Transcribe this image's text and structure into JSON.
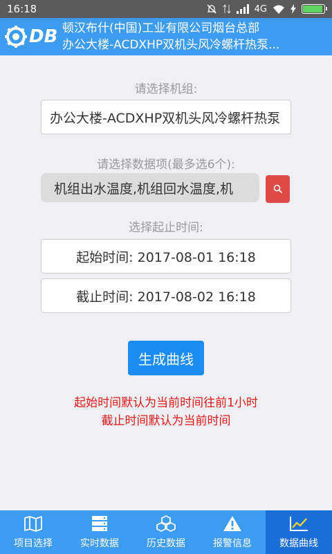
{
  "status": {
    "time": "16:18",
    "network": "4G"
  },
  "header": {
    "logo": "DB",
    "title": "顿汉布什(中国)工业有限公司烟台总部",
    "subtitle": "办公大楼-ACDXHP双机头风冷螺杆热泵..."
  },
  "form": {
    "unit_label": "请选择机组:",
    "unit_value": "办公大楼-ACDXHP双机头风冷螺杆热泵",
    "items_label": "请选择数据项(最多选6个):",
    "items_value": "机组出水温度,机组回水温度,机",
    "range_label": "选择起止时间:",
    "start_time": "起始时间: 2017-08-01 16:18",
    "end_time": "截止时间: 2017-08-02 16:18",
    "generate_label": "生成曲线",
    "note_line1": "起始时间默认为当前时间往前1小时",
    "note_line2": "截止时间默认为当前时间"
  },
  "tabs": [
    {
      "label": "项目选择",
      "icon": "map-icon"
    },
    {
      "label": "实时数据",
      "icon": "server-icon"
    },
    {
      "label": "历史数据",
      "icon": "boxes-icon"
    },
    {
      "label": "报警信息",
      "icon": "warning-icon"
    },
    {
      "label": "数据曲线",
      "icon": "line-chart-icon",
      "active": true
    }
  ],
  "colors": {
    "header": "#3d9cf0",
    "tab_active": "#1a6ed8",
    "primary_button": "#1a8cf2",
    "search_button": "#e04b47",
    "note": "#e01818"
  }
}
